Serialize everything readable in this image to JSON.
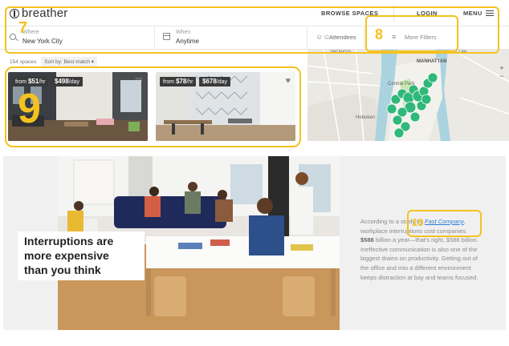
{
  "header": {
    "logo_text": "breather",
    "nav": {
      "browse": "BROWSE SPACES",
      "login": "LOGIN",
      "menu": "MENU"
    }
  },
  "search": {
    "where_label": "Where",
    "where_value": "New York City",
    "when_label": "When",
    "when_value": "Anytime",
    "attendees": "Attendees",
    "more_filters": "More Filters"
  },
  "results": {
    "count": "154 spaces",
    "sort_label": "Sort by:",
    "sort_value": "Best match"
  },
  "listings": [
    {
      "from_label": "from",
      "hourly": "$51",
      "hourly_unit": "/hr",
      "daily": "$498",
      "daily_unit": "/day"
    },
    {
      "from_label": "from",
      "hourly": "$78",
      "hourly_unit": "/hr",
      "daily": "$678",
      "daily_unit": "/day"
    }
  ],
  "map": {
    "labels": [
      "Secaucus",
      "Fort Lee",
      "MANHATTAN",
      "Central Park",
      "Hoboken"
    ],
    "zoom_in": "+",
    "zoom_out": "−"
  },
  "hero": {
    "headline_line1": "Interruptions are",
    "headline_line2": "more expensive",
    "headline_line3": "than you think",
    "quote_pre": "According to a study by ",
    "quote_link": "Fast Company",
    "quote_mid1": ", workplace interruptions cost companies ",
    "quote_bold1": "$588",
    "quote_mid2": " billion a year—that's right, $588 billion. Ineffective communication is also one of the biggest drains on productivity. Getting out of the office and into a different environment keeps distraction at bay and teams focused."
  },
  "annotations": {
    "n7": "7",
    "n8": "8",
    "n9": "9",
    "n10": "10"
  },
  "colors": {
    "annotation": "#f4c220",
    "map_pin": "#2fb87a",
    "link": "#2a7bd6"
  }
}
